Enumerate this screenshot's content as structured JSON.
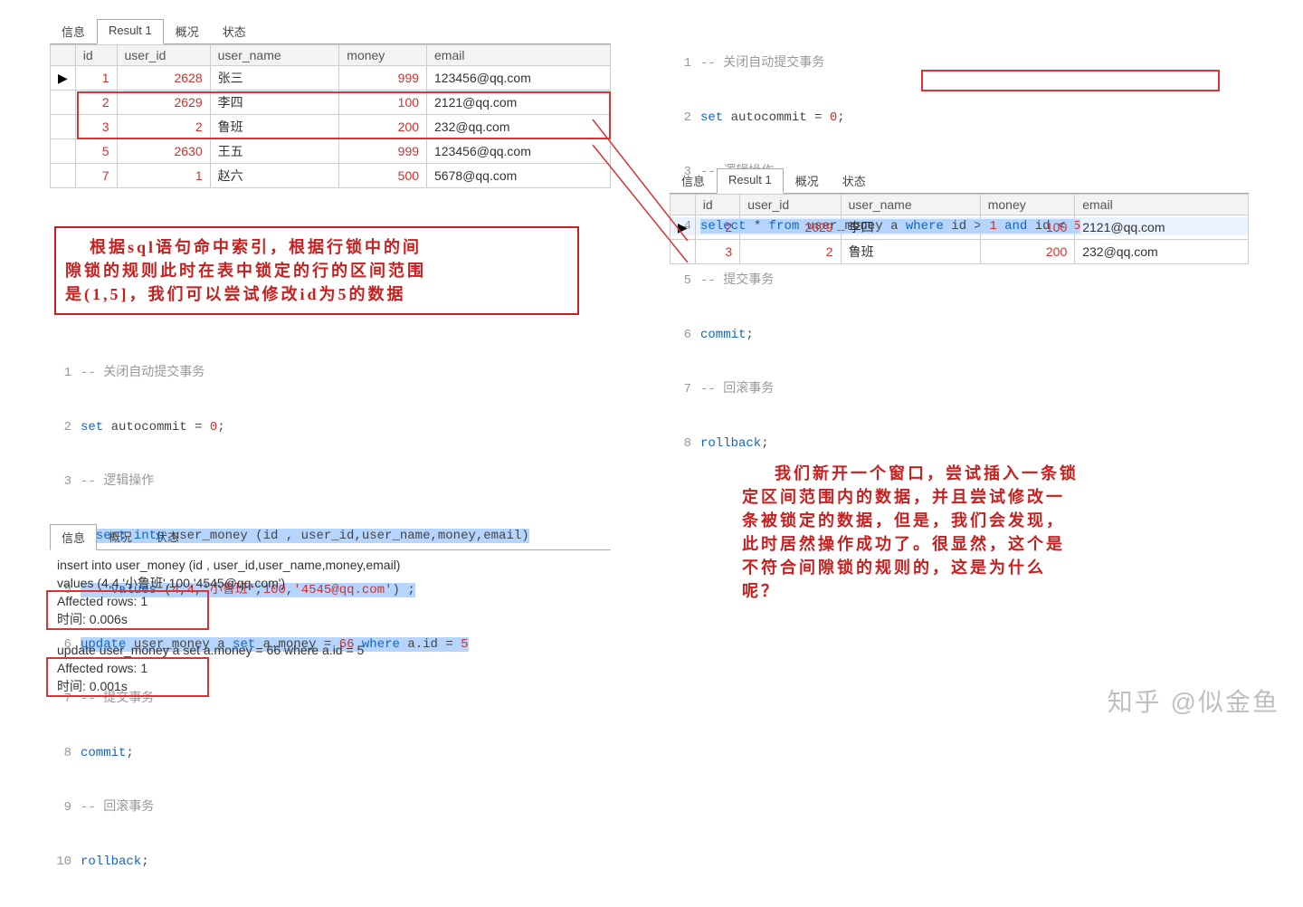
{
  "tabs_main": {
    "info": "信息",
    "result": "Result 1",
    "overview": "概况",
    "status": "状态"
  },
  "grid_left": {
    "headers": {
      "id": "id",
      "user_id": "user_id",
      "user_name": "user_name",
      "money": "money",
      "email": "email"
    },
    "row_marker": "▶",
    "rows": [
      {
        "id": "1",
        "user_id": "2628",
        "user_name": "张三",
        "money": "999",
        "email": "123456@qq.com"
      },
      {
        "id": "2",
        "user_id": "2629",
        "user_name": "李四",
        "money": "100",
        "email": "2121@qq.com"
      },
      {
        "id": "3",
        "user_id": "2",
        "user_name": "鲁班",
        "money": "200",
        "email": "232@qq.com"
      },
      {
        "id": "5",
        "user_id": "2630",
        "user_name": "王五",
        "money": "999",
        "email": "123456@qq.com"
      },
      {
        "id": "7",
        "user_id": "1",
        "user_name": "赵六",
        "money": "500",
        "email": "5678@qq.com"
      }
    ]
  },
  "anno_left": {
    "l1": "根据sql语句命中索引，根据行锁中的间",
    "l2": "隙锁的规则此时在表中锁定的行的区间范围",
    "l3": "是(1,5]，我们可以尝试修改id为5的数据"
  },
  "code_right": {
    "c1": "-- 关闭自动提交事务",
    "c2a": "set",
    "c2b": " autocommit = ",
    "c2c": "0",
    "c2d": ";",
    "c3": "-- 逻辑操作",
    "c4a": "select",
    "c4b": " * ",
    "c4c": "from",
    "c4d": " user_money a ",
    "c4e": "where",
    "c4f": " id > ",
    "c4g": "1",
    "c4h": " and",
    "c4i": " id < ",
    "c4j": "5",
    "c5": "-- 提交事务",
    "c6a": "commit",
    "c6b": ";",
    "c7": "-- 回滚事务",
    "c8a": "rollback",
    "c8b": ";"
  },
  "grid_right": {
    "rows": [
      {
        "id": "2",
        "user_id": "2629",
        "user_name": "李四",
        "money": "100",
        "email": "2121@qq.com"
      },
      {
        "id": "3",
        "user_id": "2",
        "user_name": "鲁班",
        "money": "200",
        "email": "232@qq.com"
      }
    ]
  },
  "code_bottom": {
    "c1": "-- 关闭自动提交事务",
    "c2a": "set",
    "c2b": " autocommit = ",
    "c2c": "0",
    "c2d": ";",
    "c3": "-- 逻辑操作",
    "c4a": "insert into",
    "c4b": " user_money (id , user_id,user_name,money,email)",
    "c5a": "    values",
    "c5b": " (",
    "c5c": "4",
    "c5d": ",",
    "c5e": "4",
    "c5f": ",",
    "c5g": "'小鲁班'",
    "c5h": ",",
    "c5i": "100",
    "c5j": ",",
    "c5k": "'4545@qq.com'",
    "c5l": ") ;",
    "c6a": "update",
    "c6b": " user_money a ",
    "c6c": "set",
    "c6d": " a.money = ",
    "c6e": "66",
    "c6f": " where",
    "c6g": " a.id = ",
    "c6h": "5",
    "c7": "-- 提交事务",
    "c8a": "commit",
    "c8b": ";",
    "c9": "-- 回滚事务",
    "c10a": "rollback",
    "c10b": ";"
  },
  "msg_tabs": {
    "info": "信息",
    "overview": "概况",
    "status": "状态"
  },
  "messages": {
    "m1": "insert into user_money (id , user_id,user_name,money,email)",
    "m2": "    values (4,4,'小鲁班',100,'4545@qq.com')",
    "m3": "Affected rows: 1",
    "m4": "时间: 0.006s",
    "m5": "update user_money a set a.money = 66 where a.id = 5",
    "m6": "Affected rows: 1",
    "m7": "时间: 0.001s"
  },
  "anno_right": {
    "l1": "我们新开一个窗口，尝试插入一条锁",
    "l2": "定区间范围内的数据，并且尝试修改一",
    "l3": "条被锁定的数据，但是，我们会发现，",
    "l4": "此时居然操作成功了。很显然，这个是",
    "l5": "不符合间隙锁的规则的，这是为什么",
    "l6": "呢？"
  },
  "watermark": "知乎 @似金鱼"
}
